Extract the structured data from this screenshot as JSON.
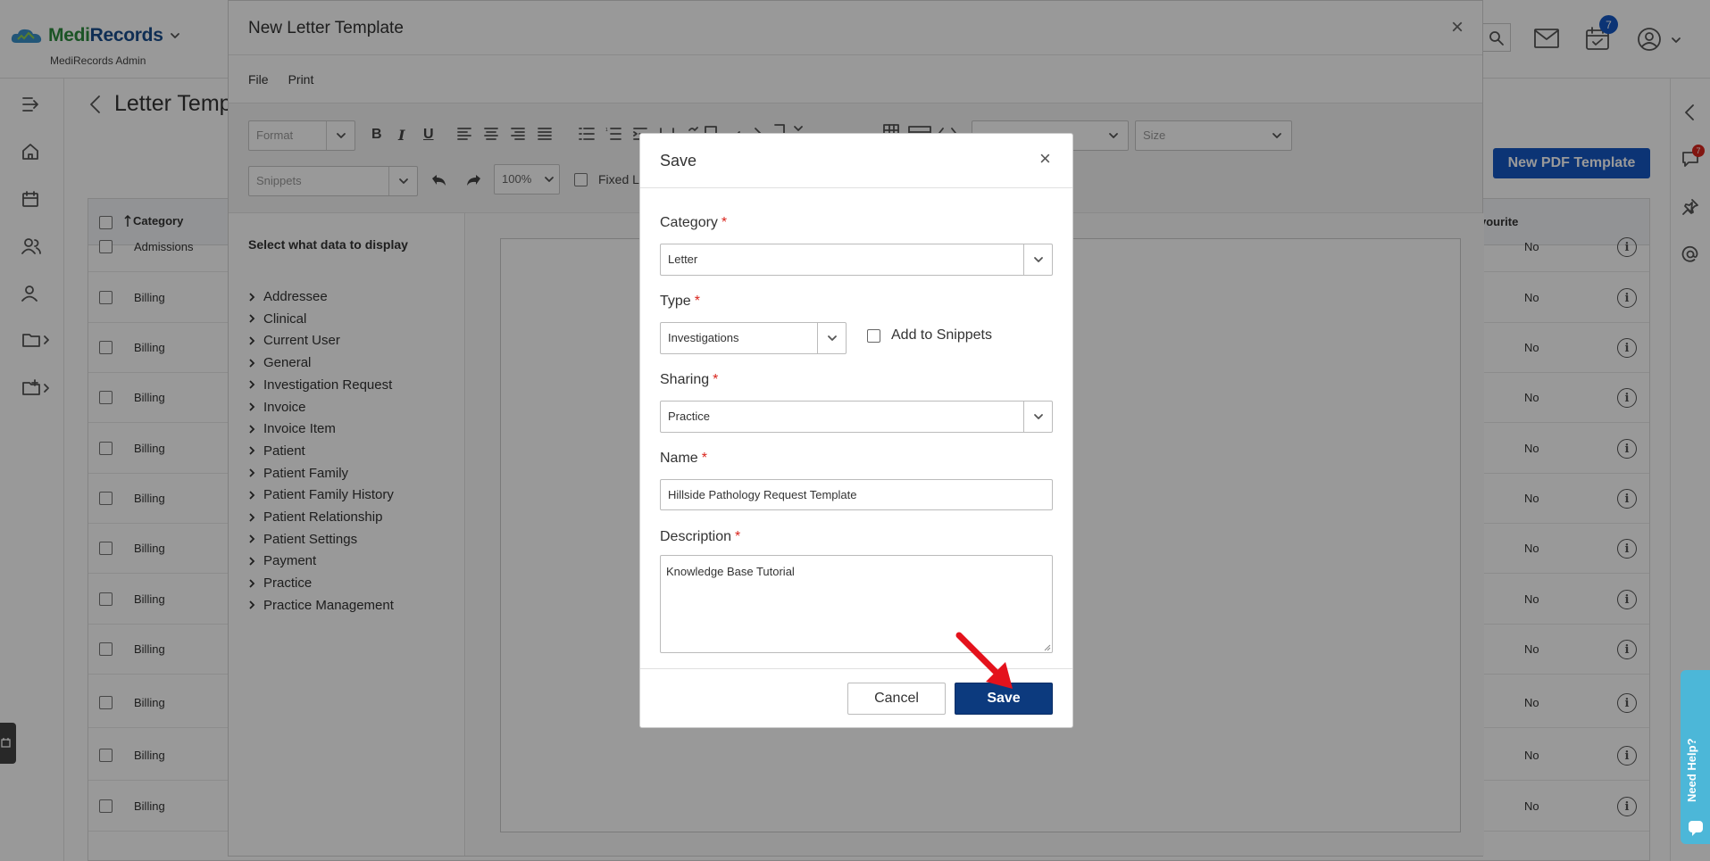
{
  "app": {
    "brand_part1": "Medi",
    "brand_part2": "Records",
    "subtitle": "MediRecords Admin",
    "calendar_badge": "7",
    "messages_badge": "7"
  },
  "page": {
    "title": "Letter Temp",
    "new_pdf_button": "New PDF Template",
    "table": {
      "header_category": "Category",
      "header_favourite": "vourite",
      "rows": [
        {
          "category": "Admissions",
          "favourite": "No"
        },
        {
          "category": "Billing",
          "favourite": "No"
        },
        {
          "category": "Billing",
          "favourite": "No"
        },
        {
          "category": "Billing",
          "favourite": "No"
        },
        {
          "category": "Billing",
          "favourite": "No"
        },
        {
          "category": "Billing",
          "favourite": "No"
        },
        {
          "category": "Billing",
          "favourite": "No"
        },
        {
          "category": "Billing",
          "favourite": "No"
        },
        {
          "category": "Billing",
          "favourite": "No"
        },
        {
          "category": "Billing",
          "favourite": "No"
        },
        {
          "category": "Billing",
          "favourite": "No"
        },
        {
          "category": "Billing",
          "favourite": "No"
        }
      ]
    }
  },
  "editor": {
    "title": "New Letter Template",
    "menu": [
      "File",
      "Print"
    ],
    "format_placeholder": "Format",
    "size_placeholder": "Size",
    "snippets_placeholder": "Snippets",
    "zoom": "100%",
    "fixed_label": "Fixed L",
    "data_title": "Select what data to display",
    "data_items": [
      "Addressee",
      "Clinical",
      "Current User",
      "General",
      "Investigation Request",
      "Invoice",
      "Invoice Item",
      "Patient",
      "Patient Family",
      "Patient Family History",
      "Patient Relationship",
      "Patient Settings",
      "Payment",
      "Practice",
      "Practice Management"
    ]
  },
  "dialog": {
    "title": "Save",
    "category_label": "Category",
    "category_value": "Letter",
    "type_label": "Type",
    "type_value": "Investigations",
    "add_to_snippets": "Add to Snippets",
    "sharing_label": "Sharing",
    "sharing_value": "Practice",
    "name_label": "Name",
    "name_value": "Hillside Pathology Request Template",
    "description_label": "Description",
    "description_value": "Knowledge Base Tutorial",
    "required_mark": "*",
    "cancel_button": "Cancel",
    "save_button": "Save"
  },
  "help": {
    "label": "Need Help?"
  },
  "colors": {
    "primary": "#0c3a7e",
    "accent_blue": "#1457c4",
    "required": "#d9251d",
    "brand_green": "#2e8b3e",
    "help_tab": "#4cb7d8",
    "arrow": "#e4121c"
  }
}
